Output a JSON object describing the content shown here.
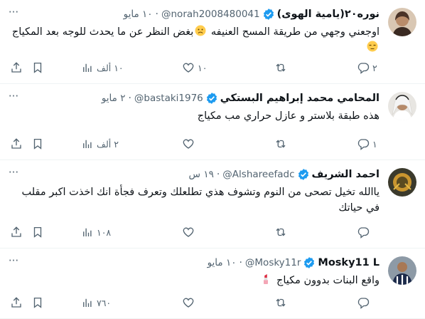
{
  "colors": {
    "text": "#0f1419",
    "secondary": "#536471",
    "verified": "#1d9bf0",
    "divider": "#eff3f4"
  },
  "tweets": [
    {
      "name": "نوره٢٠(يامية الهوى)",
      "handle": "@norah2008480041",
      "time": "١٠ مايو",
      "text_before": "اوجعني وجهي من طريقة المسح العنيفه ",
      "emoji1": "frowning-face",
      "text_after": "بغض النظر عن ما يحدث  للوجه بعد المكياج ",
      "emoji2": "unamused-face",
      "replies": "٢",
      "retweets": "",
      "likes": "١٠",
      "views": "١٠ ألف"
    },
    {
      "name": "المحامي محمد إبراهيم البستكي",
      "handle": "@bastaki1976",
      "time": "٢ مايو",
      "text": "هذه طبقة بلاستر و عازل حراري مب مكياج",
      "replies": "١",
      "retweets": "",
      "likes": "",
      "views": "٢ ألف"
    },
    {
      "name": "احمد الشريف",
      "handle": "@Alshareefadc",
      "time": "١٩ س",
      "text": "ياالله تخيل تصحى من النوم وتشوف هذي تطلعلك وتعرف فجأة انك اخذت اكبر مقلب في حياتك",
      "replies": "",
      "retweets": "",
      "likes": "",
      "views": "١٠٨"
    },
    {
      "name": "Mosky11 L",
      "handle": "@Mosky11r",
      "time": "١٠ مايو",
      "text": "واقع البنات بدوون مكياج ",
      "emoji": "lipstick",
      "replies": "",
      "retweets": "",
      "likes": "",
      "views": "٧٦٠"
    }
  ],
  "icons": {
    "more": "more-dots-icon",
    "reply": "reply-icon",
    "retweet": "retweet-icon",
    "like": "heart-icon",
    "views": "views-icon",
    "bookmark": "bookmark-icon",
    "share": "share-icon",
    "verified": "verified-badge-icon"
  }
}
